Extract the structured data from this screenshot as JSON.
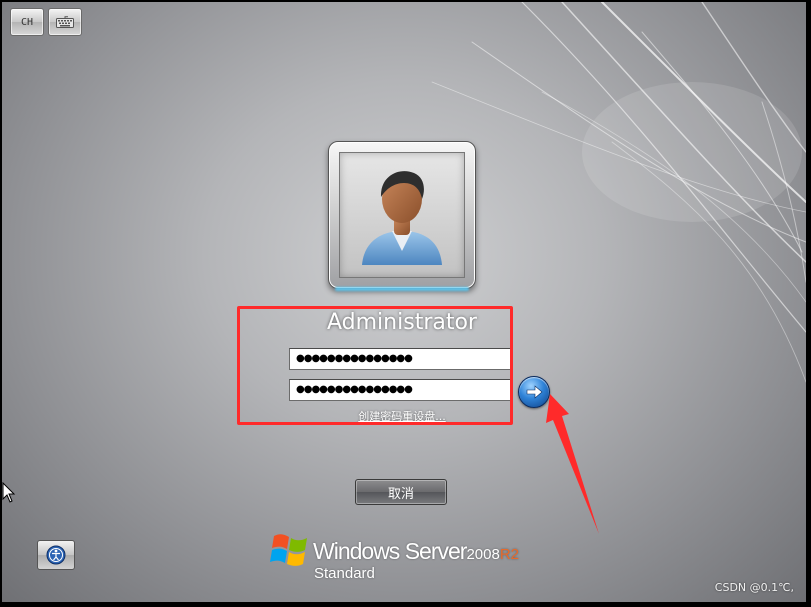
{
  "toolbar": {
    "language_label": "CH",
    "keyboard_icon": "keyboard-icon"
  },
  "user": {
    "name": "Administrator",
    "avatar_icon": "user-avatar-icon"
  },
  "form": {
    "password_mask": "●●●●●●●●●●●●●●●",
    "confirm_password_mask": "●●●●●●●●●●●●●●●",
    "submit_icon": "arrow-right-icon",
    "reset_link_label": "创建密码重设盘..."
  },
  "actions": {
    "cancel_label": "取消",
    "ease_of_access_icon": "ease-of-access-icon"
  },
  "branding": {
    "product_name": "Windows Server",
    "version": "2008",
    "release": "R2",
    "edition": "Standard"
  },
  "watermark": "CSDN @0.1℃,",
  "colors": {
    "highlight_box": "#ff2a2a",
    "annotation_arrow": "#ff2a2a",
    "submit_button": "#2f83d8",
    "r2_accent": "#e86a2a"
  }
}
